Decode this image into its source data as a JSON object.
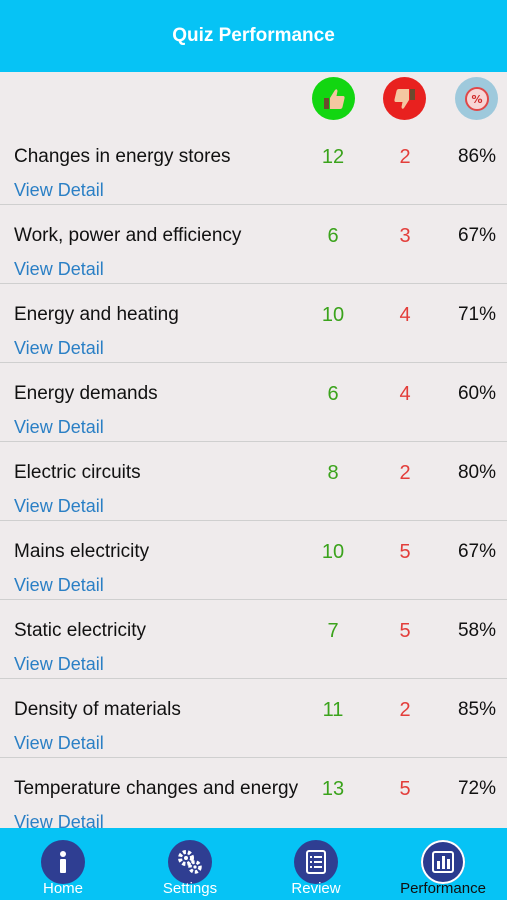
{
  "header": {
    "title": "Quiz Performance"
  },
  "columns": {
    "correct_icon": "thumbs-up-icon",
    "wrong_icon": "thumbs-down-icon",
    "percent_icon": "percent-badge-icon"
  },
  "rows": [
    {
      "topic": "Changes in energy stores",
      "correct": "12",
      "wrong": "2",
      "percent": "86%",
      "link": "View Detail"
    },
    {
      "topic": "Work, power and efficiency",
      "correct": "6",
      "wrong": "3",
      "percent": "67%",
      "link": "View Detail"
    },
    {
      "topic": "Energy and heating",
      "correct": "10",
      "wrong": "4",
      "percent": "71%",
      "link": "View Detail"
    },
    {
      "topic": "Energy demands",
      "correct": "6",
      "wrong": "4",
      "percent": "60%",
      "link": "View Detail"
    },
    {
      "topic": "Electric circuits",
      "correct": "8",
      "wrong": "2",
      "percent": "80%",
      "link": "View Detail"
    },
    {
      "topic": "Mains electricity",
      "correct": "10",
      "wrong": "5",
      "percent": "67%",
      "link": "View Detail"
    },
    {
      "topic": "Static electricity",
      "correct": "7",
      "wrong": "5",
      "percent": "58%",
      "link": "View Detail"
    },
    {
      "topic": "Density of materials",
      "correct": "11",
      "wrong": "2",
      "percent": "85%",
      "link": "View Detail"
    },
    {
      "topic": "Temperature changes and energy",
      "correct": "13",
      "wrong": "5",
      "percent": "72%",
      "link": "View Detail"
    }
  ],
  "tabbar": {
    "tabs": [
      {
        "label": "Home",
        "icon": "info-icon"
      },
      {
        "label": "Settings",
        "icon": "gears-icon"
      },
      {
        "label": "Review",
        "icon": "list-icon"
      },
      {
        "label": "Performance",
        "icon": "bar-chart-icon",
        "active": true
      }
    ]
  },
  "colors": {
    "accent": "#06c3f5",
    "correct": "#3ba31c",
    "wrong": "#e33d3a",
    "link": "#2a7fc5"
  }
}
